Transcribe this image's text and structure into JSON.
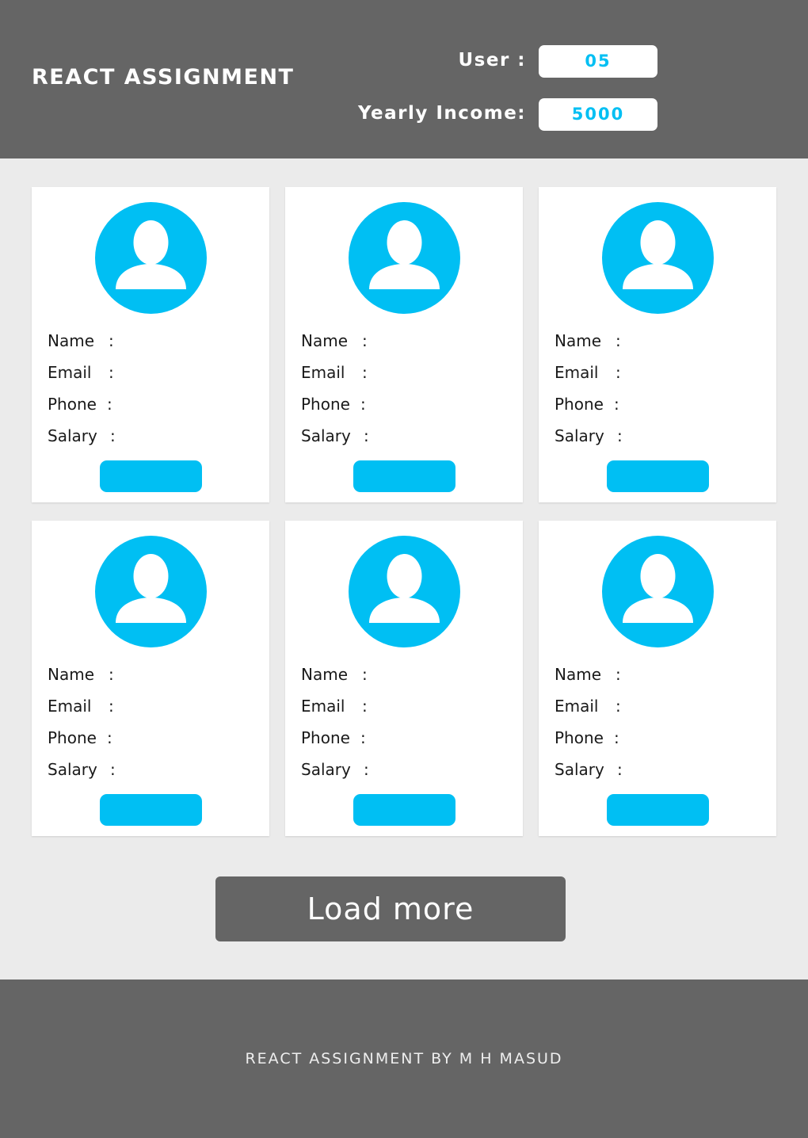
{
  "header": {
    "title": "REACT ASSIGNMENT",
    "user_label": "User :",
    "user_value": "05",
    "income_label": "Yearly Income:",
    "income_value": "5000"
  },
  "card_fields": {
    "name": "Name",
    "email": "Email",
    "phone": "Phone",
    "salary": "Salary",
    "separator": ":"
  },
  "cards": [
    {
      "name": "",
      "email": "",
      "phone": "",
      "salary": "",
      "button_label": ""
    },
    {
      "name": "",
      "email": "",
      "phone": "",
      "salary": "",
      "button_label": ""
    },
    {
      "name": "",
      "email": "",
      "phone": "",
      "salary": "",
      "button_label": ""
    },
    {
      "name": "",
      "email": "",
      "phone": "",
      "salary": "",
      "button_label": ""
    },
    {
      "name": "",
      "email": "",
      "phone": "",
      "salary": "",
      "button_label": ""
    },
    {
      "name": "",
      "email": "",
      "phone": "",
      "salary": "",
      "button_label": ""
    }
  ],
  "load_more_label": "Load more",
  "footer": {
    "text": "REACT ASSIGNMENT BY M H MASUD"
  },
  "colors": {
    "header_bg": "#656565",
    "page_bg": "#ebebeb",
    "accent": "#00bff3",
    "card_bg": "#ffffff"
  },
  "icons": {
    "avatar": "user-avatar-icon"
  }
}
